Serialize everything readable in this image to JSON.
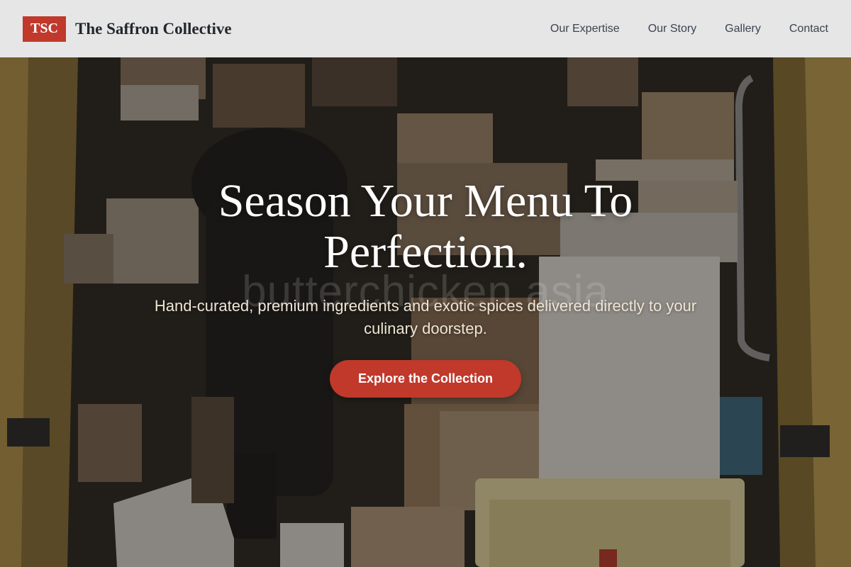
{
  "header": {
    "logo_text": "TSC",
    "brand_name": "The Saffron Collective",
    "nav": [
      {
        "label": "Our Expertise"
      },
      {
        "label": "Our Story"
      },
      {
        "label": "Gallery"
      },
      {
        "label": "Contact"
      }
    ]
  },
  "hero": {
    "title": "Season Your Menu To Perfection.",
    "subtitle": "Hand-curated, premium ingredients and exotic spices delivered directly to your culinary doorstep.",
    "cta_label": "Explore the Collection",
    "watermark": "butterchicken.asia",
    "image": "delivery van full of cardboard parcels"
  },
  "colors": {
    "accent": "#c0392b",
    "header_bg": "#ececec",
    "brand_text": "#23272f",
    "nav_text": "#3c4350",
    "hero_title": "#ffffff",
    "hero_subtitle": "#efe5d4",
    "van_yellow": "#c9a84a"
  }
}
